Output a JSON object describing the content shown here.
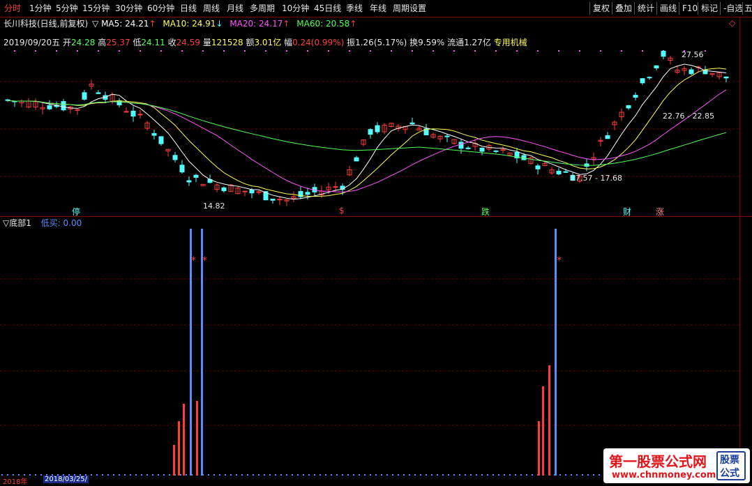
{
  "toolbar": {
    "tabs": [
      "分时",
      "1分钟",
      "5分钟",
      "15分钟",
      "30分钟",
      "60分钟",
      "日线",
      "周线",
      "月线",
      "多周期",
      "10分钟",
      "45日线",
      "季线",
      "年线",
      "周期设置"
    ],
    "active": 0,
    "right_buttons": [
      "复权",
      "叠加",
      "统计",
      "画线",
      "F10",
      "标记",
      "-自选",
      "五"
    ]
  },
  "stock_bar": {
    "name": "长川科技(日线,前复权)",
    "ma5": "MA5: 24.21",
    "ma10": "MA10: 24.91",
    "ma20": "MA20: 24.17",
    "ma60": "MA60: 20.58",
    "arrow_up": "↑",
    "arrow_down": "↓",
    "diamond": "◇"
  },
  "quote_bar": {
    "date": "2019/09/20五",
    "open_l": "开",
    "open": "24.28",
    "high_l": "高",
    "high": "25.37",
    "low_l": "低",
    "low": "24.11",
    "close_l": "收",
    "close": "24.59",
    "vol_l": "量",
    "vol": "121528",
    "amt_l": "额",
    "amt": "3.01亿",
    "chg_l": "幅",
    "chg": "0.24(0.99%)",
    "amp": "振1.26(5.17%)",
    "turn": "换9.59%",
    "float": "流通1.27亿",
    "sector": "专用机械"
  },
  "annotations": {
    "max": "27.56",
    "min": "14.82",
    "range1": "22.76 - 22.85",
    "range2": "17.57 - 17.68",
    "events": [
      "停",
      "$",
      "跌",
      "财",
      "涨"
    ]
  },
  "indicator": {
    "title": "▽底部1",
    "label": "低买: 0.00",
    "star": "*"
  },
  "dates": [
    "2018年",
    "2018/03/25/"
  ],
  "watermark": {
    "title": "第一股票公式网",
    "url": "www.chnmoney.com",
    "badge1": "股票",
    "badge2": "公式"
  },
  "colors": {
    "up": "#ff3c3c",
    "down": "#54ffff",
    "ma5": "#ffffff",
    "ma10": "#ffff55",
    "ma20": "#ff55ff",
    "ma60": "#55ff55",
    "signal": "#5c8cff"
  }
}
